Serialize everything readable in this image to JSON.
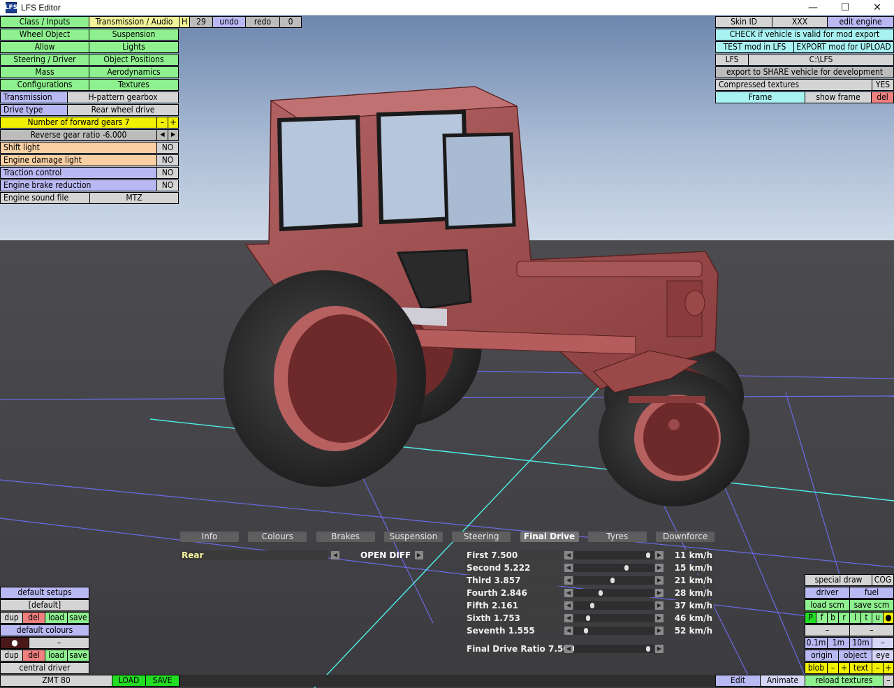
{
  "window": {
    "title": "LFS Editor",
    "app_icon": "LFS",
    "minimize": "—",
    "maximize": "☐",
    "close": "✕"
  },
  "left_menu": {
    "class_inputs": "Class / Inputs",
    "transmission_audio": "Transmission / Audio",
    "h": "H",
    "n29": "29",
    "undo": "undo",
    "redo": "redo",
    "zero": "0",
    "wheel_object": "Wheel Object",
    "suspension": "Suspension",
    "allow": "Allow",
    "lights": "Lights",
    "steering_driver": "Steering / Driver",
    "object_positions": "Object Positions",
    "mass": "Mass",
    "aerodynamics": "Aerodynamics",
    "configurations": "Configurations",
    "textures": "Textures"
  },
  "trans_props": {
    "transmission_label": "Transmission",
    "transmission_value": "H-pattern gearbox",
    "drive_type_label": "Drive type",
    "drive_type_value": "Rear wheel drive",
    "forward_gears": "Number of forward gears 7",
    "minus": "–",
    "plus": "+",
    "reverse_ratio": "Reverse gear ratio -6.000",
    "left_arrow": "◀",
    "right_arrow": "▶",
    "shift_light": "Shift light",
    "shift_light_value": "NO",
    "engine_damage_light": "Engine damage light",
    "engine_damage_light_value": "NO",
    "traction_control": "Traction control",
    "traction_control_value": "NO",
    "engine_brake_reduction": "Engine brake reduction",
    "engine_brake_reduction_value": "NO",
    "engine_sound_file": "Engine sound file",
    "engine_sound_value": "MTZ"
  },
  "right_menu": {
    "skin_id": "Skin ID",
    "skin_value": "XXX",
    "edit_engine": "edit engine",
    "check_valid": "CHECK if vehicle is valid for mod export",
    "test_mod": "TEST mod in LFS",
    "export_upload": "EXPORT mod for UPLOAD",
    "lfs": "LFS",
    "lfs_path": "C:\\LFS",
    "export_share": "export to SHARE vehicle for development",
    "compressed_textures": "Compressed textures",
    "compressed_value": "YES",
    "frame": "Frame",
    "show_frame": "show frame",
    "del": "del"
  },
  "tabs": [
    {
      "label": "Info",
      "active": false
    },
    {
      "label": "Colours",
      "active": false
    },
    {
      "label": "Brakes",
      "active": false
    },
    {
      "label": "Suspension",
      "active": false
    },
    {
      "label": "Steering",
      "active": false
    },
    {
      "label": "Final Drive",
      "active": true
    },
    {
      "label": "Tyres",
      "active": false
    },
    {
      "label": "Downforce",
      "active": false
    }
  ],
  "setup": {
    "axle_value": "Rear",
    "diff_value": "OPEN DIFF",
    "gears": [
      {
        "label": "First 7.500",
        "slider": 0.97,
        "speed": "11 km/h"
      },
      {
        "label": "Second 5.222",
        "slider": 0.68,
        "speed": "15 km/h"
      },
      {
        "label": "Third 3.857",
        "slider": 0.49,
        "speed": "21 km/h"
      },
      {
        "label": "Fourth 2.846",
        "slider": 0.33,
        "speed": "28 km/h"
      },
      {
        "label": "Fifth 2.161",
        "slider": 0.22,
        "speed": "37 km/h"
      },
      {
        "label": "Sixth 1.753",
        "slider": 0.16,
        "speed": "46 km/h"
      },
      {
        "label": "Seventh 1.555",
        "slider": 0.13,
        "speed": "52 km/h"
      }
    ],
    "final_drive": {
      "label": "Final Drive Ratio 7.500",
      "slider": 0.97
    }
  },
  "bottom_left": {
    "default_setups": "default setups",
    "default_setup_value": "[default]",
    "dup": "dup",
    "del": "del",
    "load": "load",
    "save": "save",
    "default_colours": "default colours",
    "colour_dot": "●",
    "colour_dash": "–",
    "central_driver": "central driver",
    "car_name": "ZMT 80",
    "load_caps": "LOAD",
    "save_caps": "SAVE"
  },
  "bottom_right": {
    "special_draw": "special draw",
    "cog": "COG",
    "driver": "driver",
    "fuel": "fuel",
    "load_scm": "load scm",
    "save_scm": "save scm",
    "letters": [
      "P",
      "f",
      "b",
      "r",
      "l",
      "t",
      "u"
    ],
    "dot": "●",
    "dash": "–",
    "s01": "0.1m",
    "s1": "1m",
    "s10": "10m",
    "origin": "origin",
    "object": "object",
    "eye": "eye",
    "blob": "blob",
    "minus": "–",
    "plus": "+",
    "text": "text",
    "edit": "Edit",
    "animate": "Animate",
    "reload_textures": "reload textures"
  }
}
